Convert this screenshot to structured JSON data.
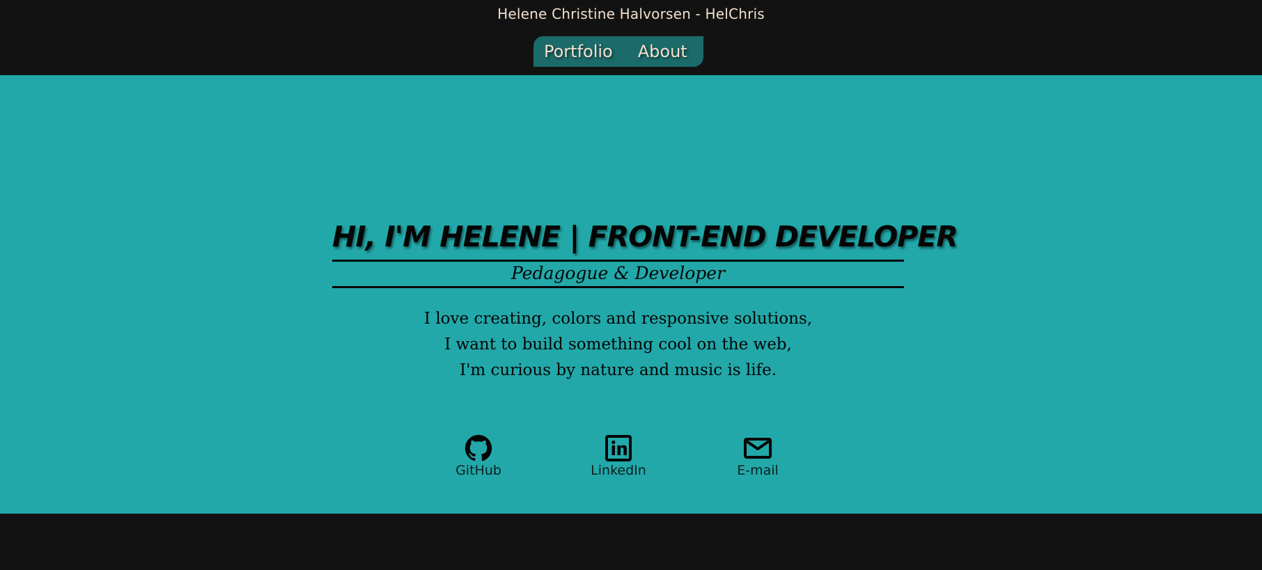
{
  "header": {
    "site_title": "Helene Christine Halvorsen - HelChris",
    "nav": [
      {
        "label": "Portfolio"
      },
      {
        "label": "About"
      }
    ]
  },
  "hero": {
    "headline": "HI, I'M HELENE | FRONT-END DEVELOPER",
    "subtitle": "Pedagogue & Developer",
    "tagline_lines": [
      "I love creating, colors and responsive solutions,",
      "I want to build something cool on the web,",
      "I'm curious by nature and music is life."
    ]
  },
  "social_links": [
    {
      "label": "GitHub",
      "icon": "github-icon"
    },
    {
      "label": "LinkedIn",
      "icon": "linkedin-icon"
    },
    {
      "label": "E-mail",
      "icon": "mail-icon"
    }
  ],
  "colors": {
    "background": "#121212",
    "hero": "#22a8a9",
    "nav": "#1b6b6a",
    "title_text": "#f2e0cf"
  }
}
